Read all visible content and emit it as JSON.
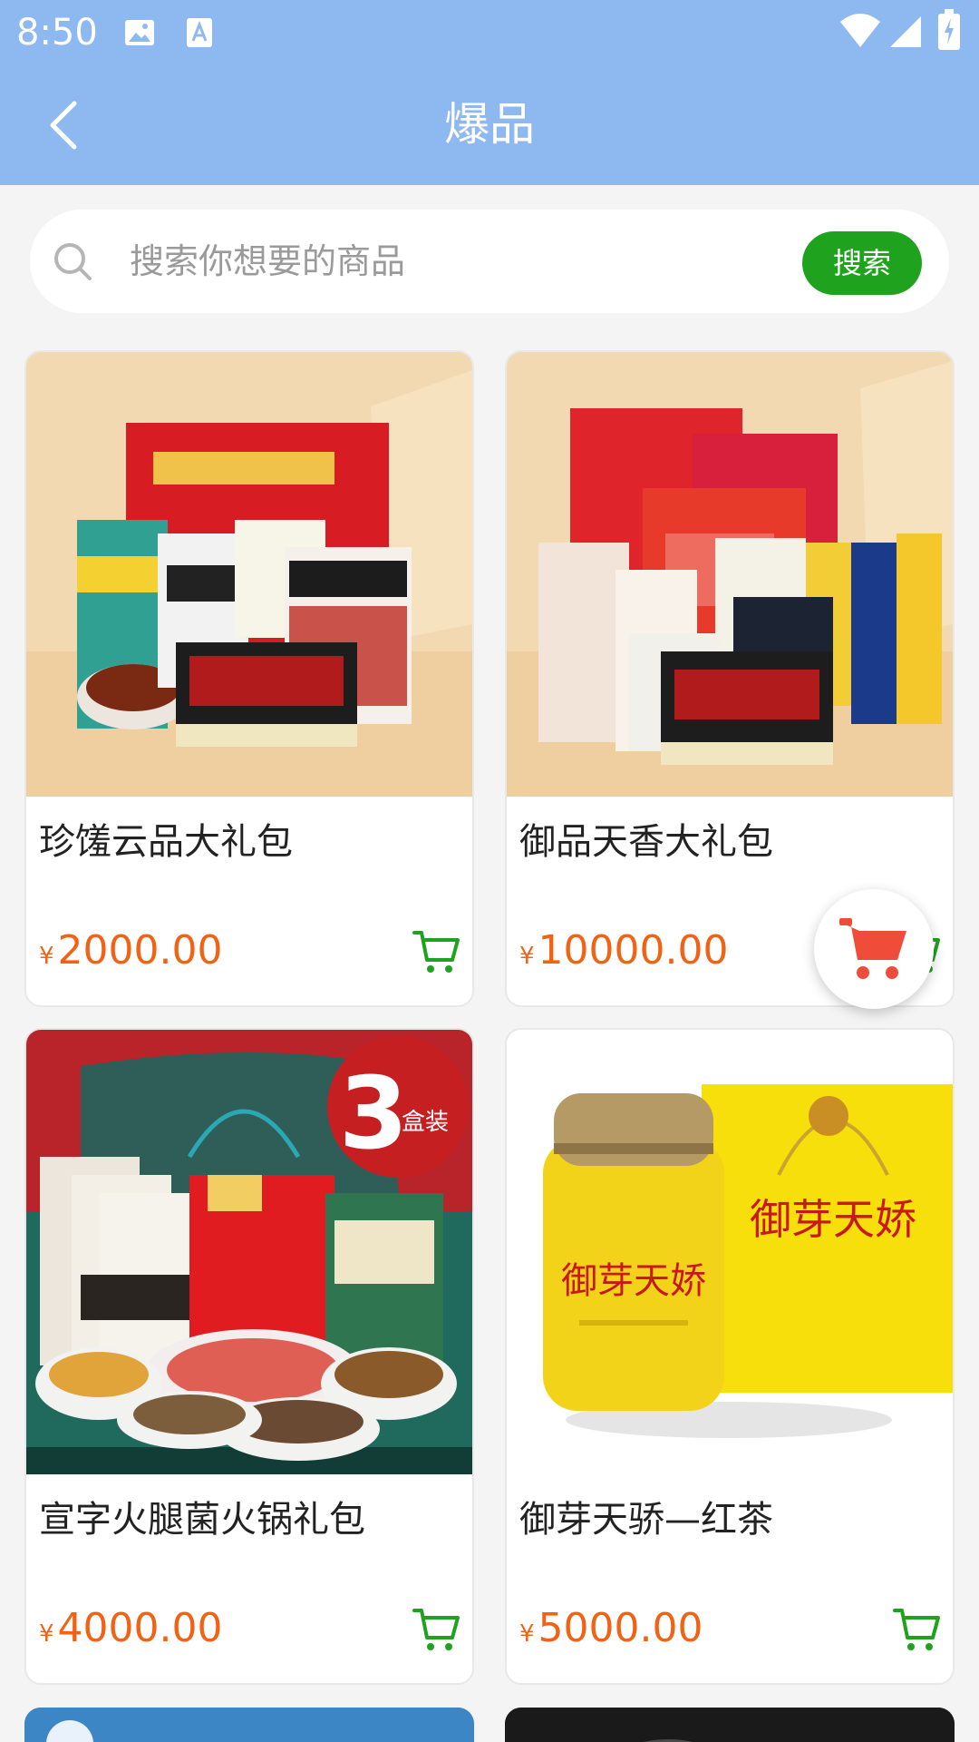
{
  "status_bar": {
    "time": "8:50"
  },
  "header": {
    "title": "爆品"
  },
  "search": {
    "placeholder": "搜索你想要的商品",
    "button_label": "搜索"
  },
  "products": [
    {
      "name": "珍馐云品大礼包",
      "currency": "¥",
      "price": "2000.00"
    },
    {
      "name": "御品天香大礼包",
      "currency": "¥",
      "price": "10000.00"
    },
    {
      "name": "宣字火腿菌火锅礼包",
      "currency": "¥",
      "price": "4000.00"
    },
    {
      "name": "御芽天骄—红茶",
      "currency": "¥",
      "price": "5000.00"
    }
  ],
  "image_texts": {
    "p3_badge_number": "3",
    "p3_badge_text": "盒装",
    "p4_brand": "御芽天娇"
  },
  "colors": {
    "theme": "#8db8f0",
    "price": "#f06314",
    "search_button": "#1fa31f",
    "cart_icon": "#1fa31f",
    "float_cart": "#f04c3a"
  },
  "icons": [
    "back-arrow-icon",
    "search-icon",
    "cart-icon",
    "floating-cart-icon",
    "wifi-icon",
    "signal-icon",
    "battery-icon",
    "image-notification-icon",
    "font-notification-icon"
  ]
}
